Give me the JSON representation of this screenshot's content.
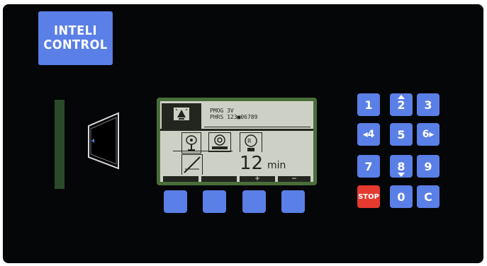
{
  "logo": {
    "line1": "INTELI",
    "line2": "CONTROL"
  },
  "display": {
    "header_line1": "PMOG 3V",
    "header_line2": "PHRS 123■06789",
    "value": "12",
    "unit": "min",
    "softkey_plus": "+",
    "softkey_minus": "−"
  },
  "keypad": {
    "k1": "1",
    "k2": "2",
    "k3": "3",
    "k4": "◂4",
    "k5": "5",
    "k6": "6▸",
    "k7": "7",
    "k8": "8",
    "k9": "9",
    "stop": "STOP",
    "k0": "0",
    "clear": "C"
  },
  "colors": {
    "button": "#5a7fe6",
    "stop": "#e53a2f",
    "lcd": "#cdd1c5",
    "bezel": "#4a6e3a"
  }
}
